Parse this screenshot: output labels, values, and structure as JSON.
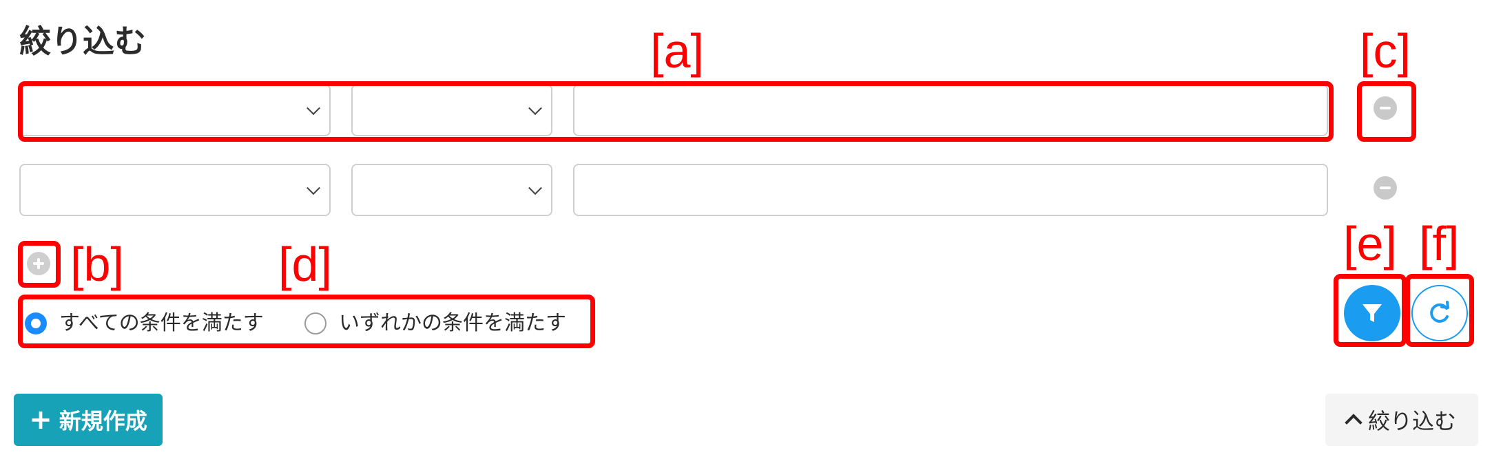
{
  "filter": {
    "title": "絞り込む",
    "add_icon": "plus-circle-icon",
    "remove_icon": "minus-circle-icon",
    "rows": [
      {
        "field": "",
        "operator": "",
        "value": ""
      },
      {
        "field": "",
        "operator": "",
        "value": ""
      }
    ],
    "match_options": [
      {
        "label": "すべての条件を満たす",
        "selected": true
      },
      {
        "label": "いずれかの条件を満たす",
        "selected": false
      }
    ],
    "apply_icon": "filter-icon",
    "reset_icon": "refresh-icon"
  },
  "annotations": {
    "a": "[a]",
    "b": "[b]",
    "c": "[c]",
    "d": "[d]",
    "e": "[e]",
    "f": "[f]",
    "color": "#ff0000"
  },
  "footer": {
    "new_button": "新規作成",
    "new_icon": "plus-icon",
    "collapse_button": "絞り込む",
    "collapse_icon": "chevron-up-icon"
  },
  "colors": {
    "primary": "#1a9cf0",
    "teal": "#17a2b8",
    "radio_checked": "#1a8cff"
  }
}
